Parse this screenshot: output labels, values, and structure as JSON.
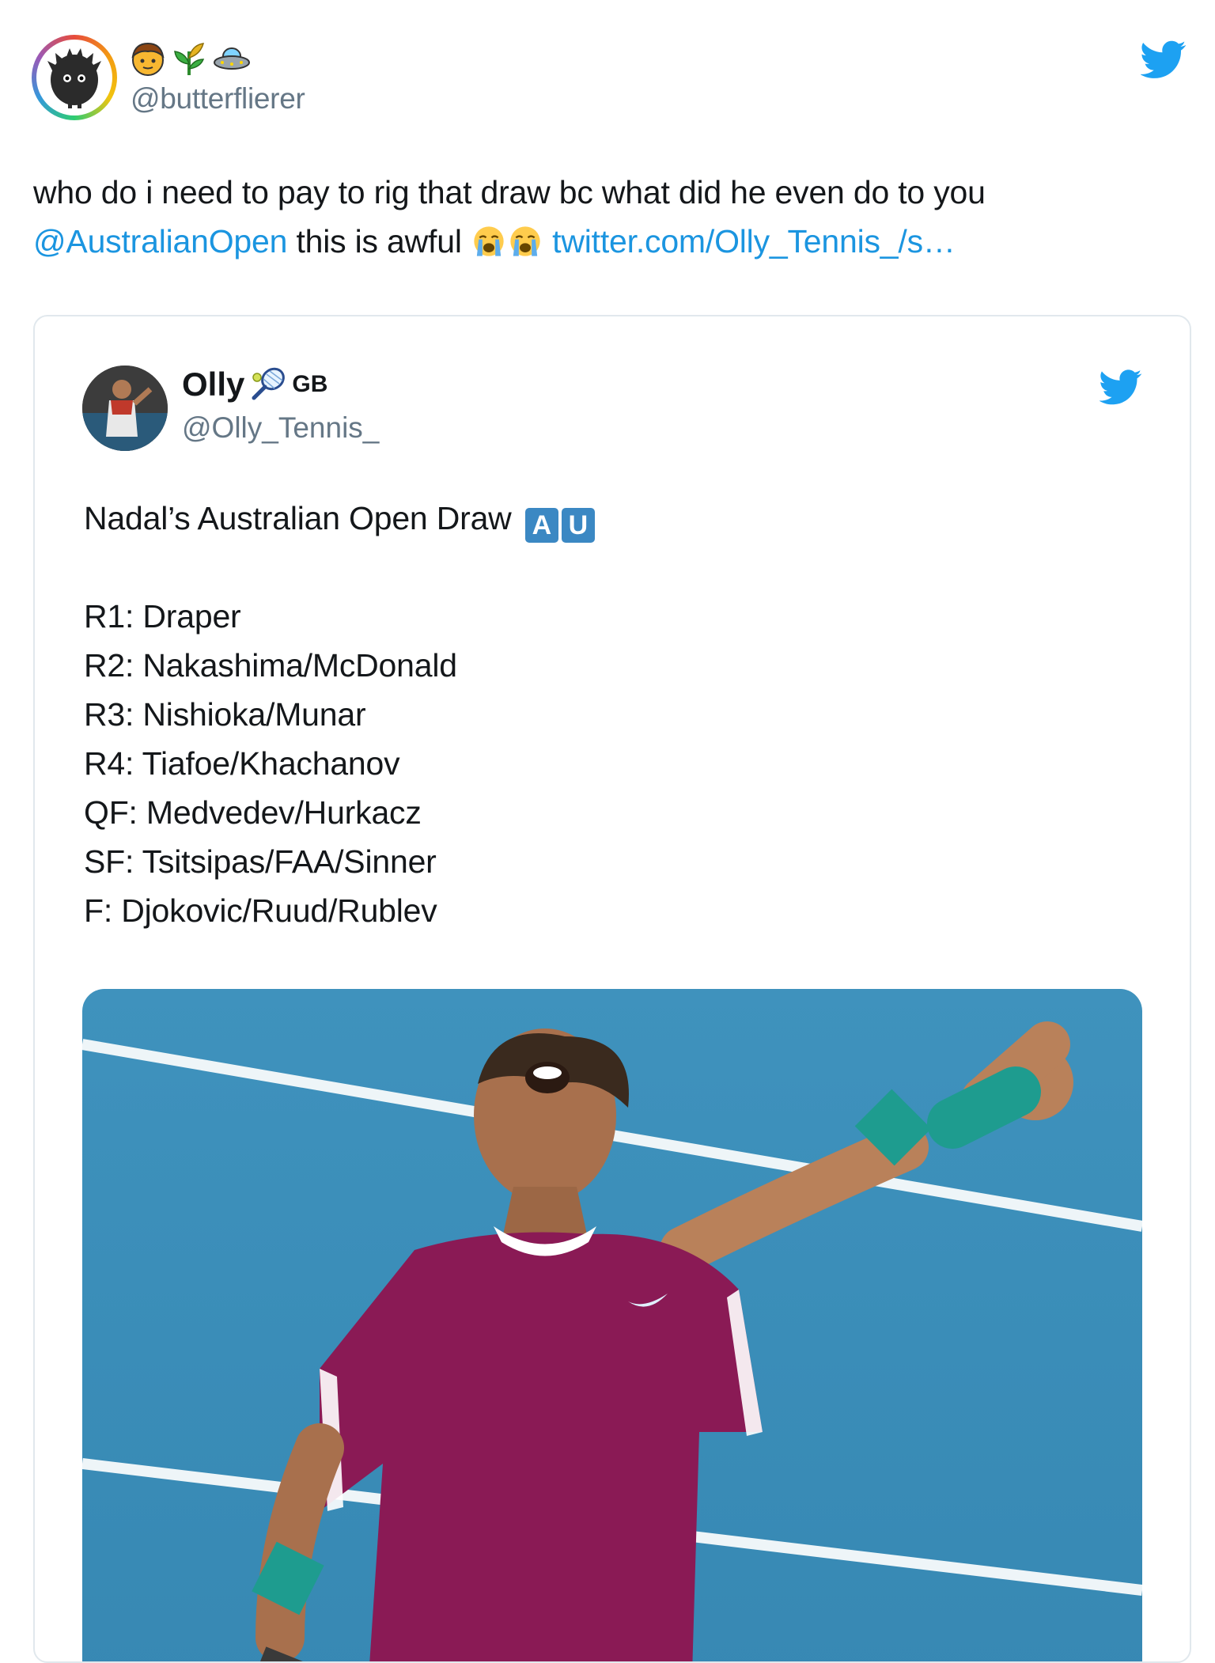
{
  "outer_tweet": {
    "handle": "@butterflierer",
    "name_emojis": [
      "person-emoji",
      "rice-plant-emoji",
      "ufo-emoji"
    ],
    "text_before": "who do i need to pay to rig that draw bc what did he even do to you ",
    "mention": "@AustralianOpen",
    "text_middle": " this is awful ",
    "emojis": [
      "loudly-crying-face",
      "loudly-crying-face"
    ],
    "link": "twitter.com/Olly_Tennis_/s…"
  },
  "quoted_tweet": {
    "name": "Olly",
    "name_icon": "tennis-racket-emoji",
    "flag_text": "GB",
    "handle": "@Olly_Tennis_",
    "headline": "Nadal’s Australian Open Draw",
    "flag_letters": [
      "A",
      "U"
    ],
    "draw": [
      "R1: Draper",
      "R2: Nakashima/McDonald",
      "R3: Nishioka/Munar",
      "R4: Tiafoe/Khachanov",
      "QF: Medvedev/Hurkacz",
      "SF: Tsitsipas/FAA/Sinner",
      "F: Djokovic/Ruud/Rublev"
    ]
  },
  "colors": {
    "twitter_blue": "#1da1f2",
    "link_blue": "#1b95e0",
    "secondary_text": "#657786",
    "court_blue": "#3a8db8",
    "shirt_purple": "#8a1a55",
    "wristband_teal": "#1e9c8f"
  }
}
